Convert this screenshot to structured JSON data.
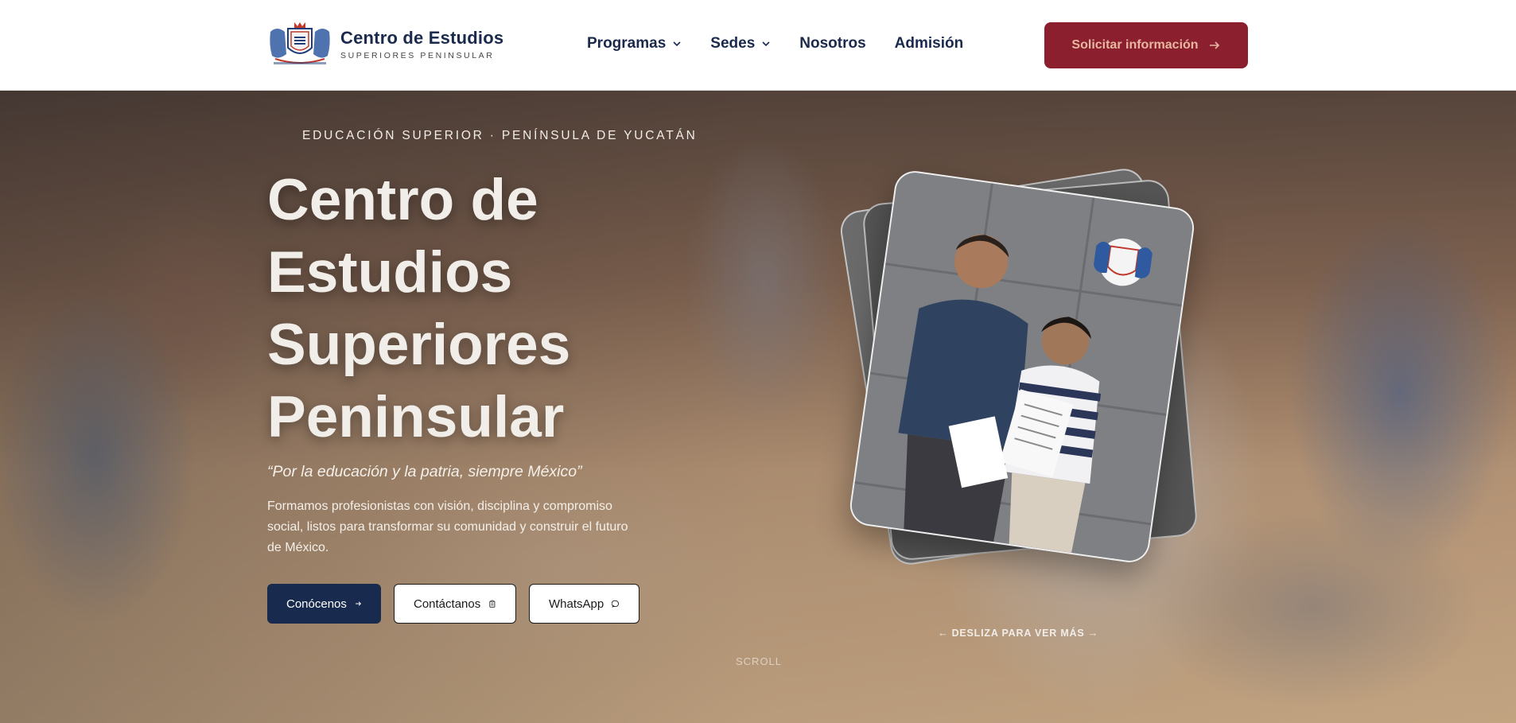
{
  "brand": {
    "title": "Centro de Estudios",
    "subtitle": "SUPERIORES PENINSULAR",
    "logo_icon": "crest-logo-icon"
  },
  "nav": {
    "items": [
      {
        "label": "Programas",
        "has_dropdown": true
      },
      {
        "label": "Sedes",
        "has_dropdown": true
      },
      {
        "label": "Nosotros",
        "has_dropdown": false
      },
      {
        "label": "Admisión",
        "has_dropdown": false
      }
    ],
    "cta_label": "Solicitar información"
  },
  "hero": {
    "eyebrow": "EDUCACIÓN SUPERIOR · PENÍNSULA DE YUCATÁN",
    "title": "Centro de Estudios Superiores Peninsular",
    "quote": "“Por la educación y la patria, siempre México”",
    "description": "Formamos profesionistas con visión, disciplina y compromiso social, listos para transformar su comunidad y construir el futuro de México.",
    "buttons": {
      "primary": "Conócenos",
      "contact": "Contáctanos",
      "whatsapp": "WhatsApp"
    },
    "swipe_hint": "← DESLIZA PARA VER MÁS →",
    "scroll_label": "SCROLL"
  },
  "colors": {
    "navy": "#182a4e",
    "maroon": "#8b1f2e",
    "cta_text": "#e7b7a2"
  }
}
